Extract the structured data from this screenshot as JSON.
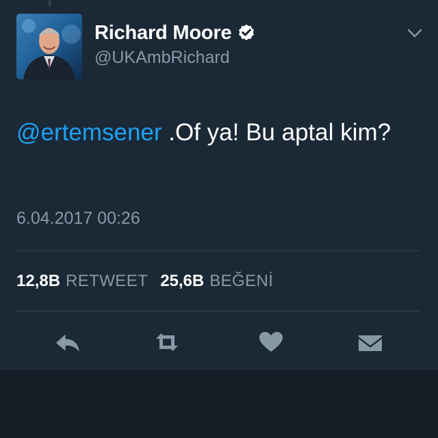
{
  "user": {
    "display_name": "Richard Moore",
    "handle": "@UKAmbRichard",
    "verified": true,
    "avatar_icon": "profile-photo"
  },
  "tweet": {
    "mention": "@ertemsener",
    "text": " .Of ya!  Bu aptal kim?",
    "timestamp": "6.04.2017 00:26"
  },
  "stats": {
    "retweet_count": "12,8B",
    "retweet_label": "RETWEET",
    "like_count": "25,6B",
    "like_label": "BEĞENİ"
  },
  "actions": {
    "reply_icon": "reply-icon",
    "retweet_icon": "retweet-icon",
    "like_icon": "heart-icon",
    "dm_icon": "envelope-icon"
  },
  "colors": {
    "background": "#1b2836",
    "accent": "#1da1f2",
    "secondary_text": "#8899a6",
    "divider": "#38444d"
  }
}
